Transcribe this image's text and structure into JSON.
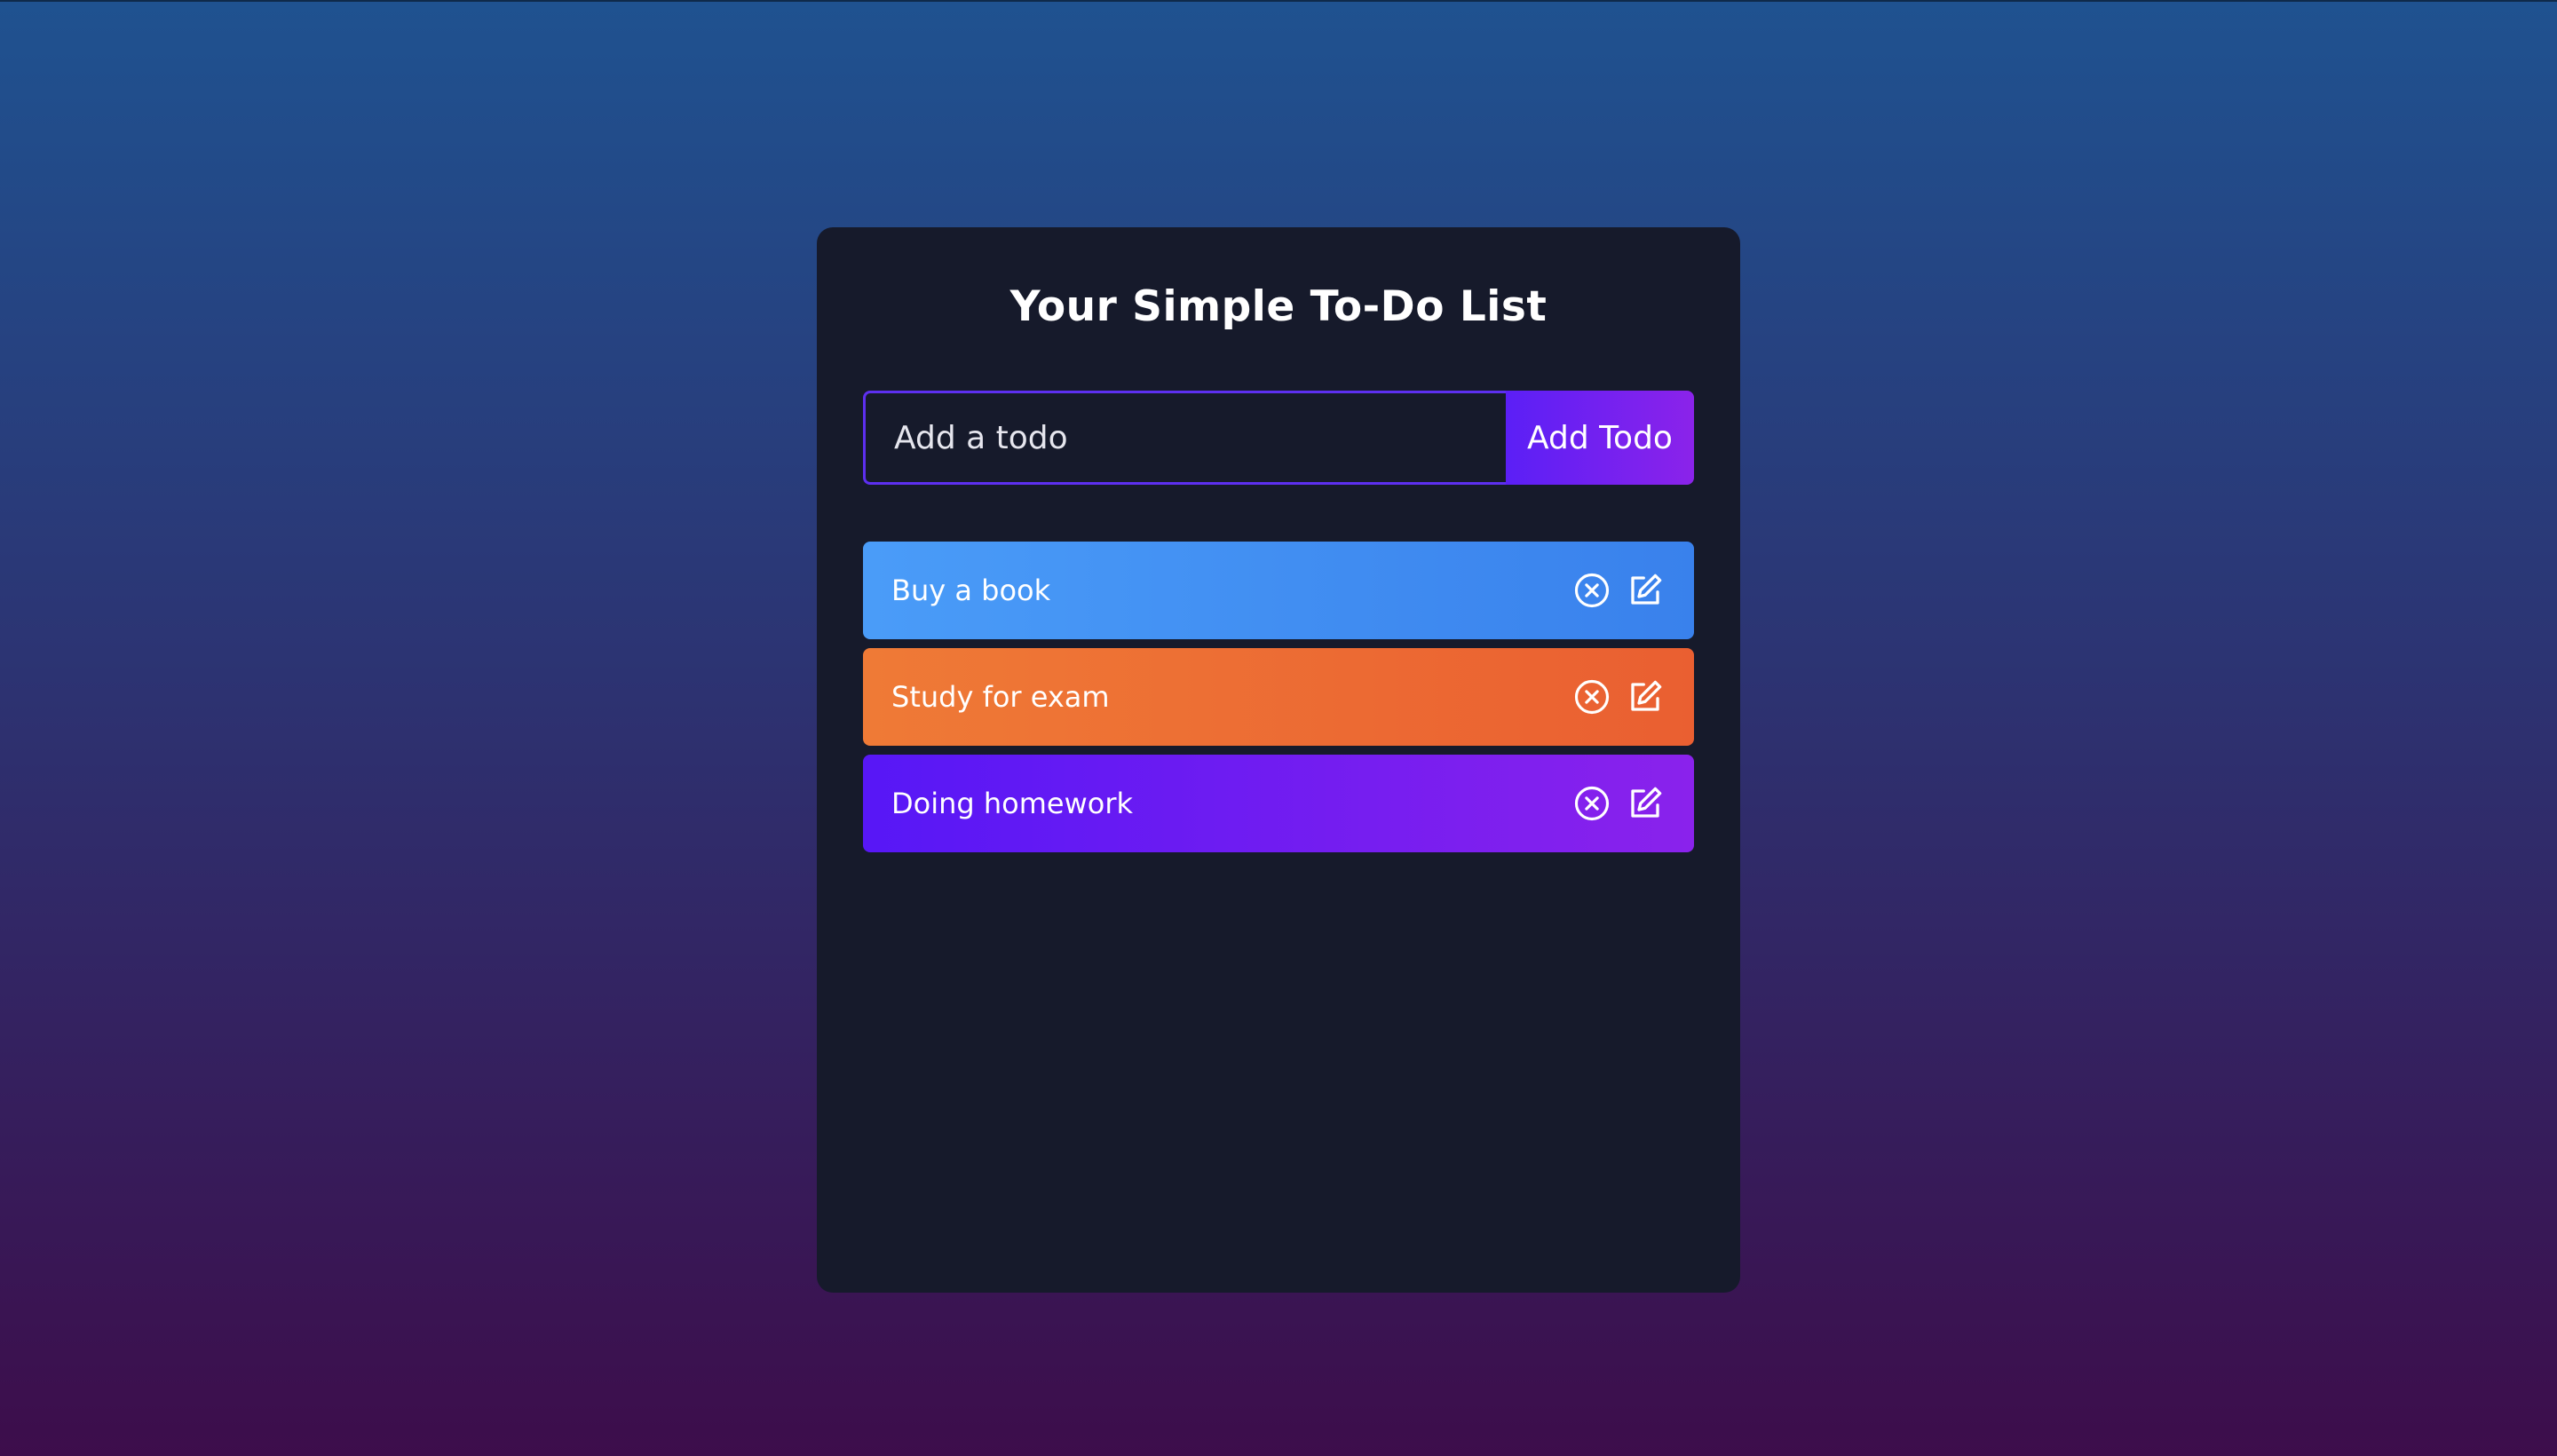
{
  "app": {
    "title": "Your Simple To-Do List"
  },
  "form": {
    "input_value": "",
    "input_placeholder": "Add a todo",
    "add_button_label": "Add Todo"
  },
  "todos": [
    {
      "text": "Buy a book",
      "color": "#4a9cf8",
      "icons": [
        "close-circle-icon",
        "edit-icon"
      ]
    },
    {
      "text": "Study for exam",
      "color": "#ef7a36",
      "icons": [
        "close-circle-icon",
        "edit-icon"
      ]
    },
    {
      "text": "Doing homework",
      "color": "#5717f6",
      "icons": [
        "close-circle-icon",
        "edit-icon"
      ]
    }
  ],
  "colors": {
    "card_background": "#161a2b",
    "accent": "#5b1ff6",
    "accent_end": "#8b23ea",
    "page_gradient_top": "#1f5290",
    "page_gradient_bottom": "#3d0d4b"
  }
}
